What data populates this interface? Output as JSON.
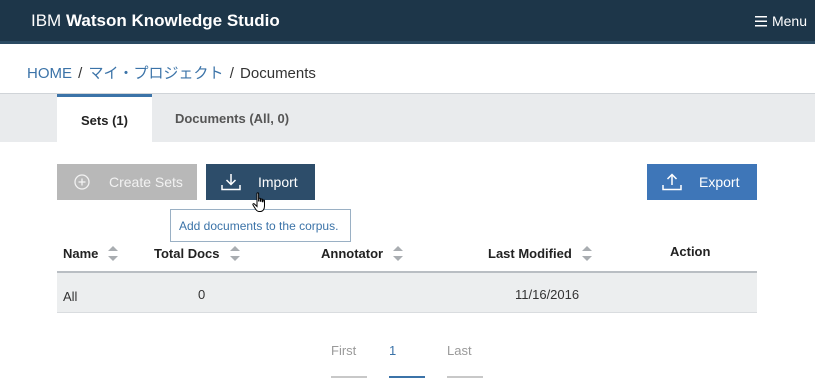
{
  "header": {
    "brand_prefix": "IBM",
    "brand_name": "Watson Knowledge Studio",
    "menu_label": "Menu"
  },
  "breadcrumb": {
    "home": "HOME",
    "separator": "/",
    "project": "マイ・プロジェクト",
    "current": "Documents"
  },
  "tabs": [
    {
      "label": "Sets (1)",
      "active": true
    },
    {
      "label": "Documents (All, 0)",
      "active": false
    }
  ],
  "toolbar": {
    "create_label": "Create Sets",
    "import_label": "Import",
    "export_label": "Export",
    "import_tooltip": "Add documents to the corpus."
  },
  "table": {
    "columns": [
      "Name",
      "Total Docs",
      "Annotator",
      "Last Modified",
      "Action"
    ],
    "rows": [
      {
        "name": "All",
        "total_docs": "0",
        "annotator": "",
        "last_modified": "11/16/2016",
        "action": ""
      }
    ]
  },
  "pagination": {
    "first": "First",
    "current": "1",
    "last": "Last"
  },
  "colors": {
    "header_bg": "#1d3649",
    "link": "#3b73a8",
    "import_button": "#2d4d6a",
    "export_button": "#3e76b8",
    "disabled_button": "#b8b8b8"
  }
}
